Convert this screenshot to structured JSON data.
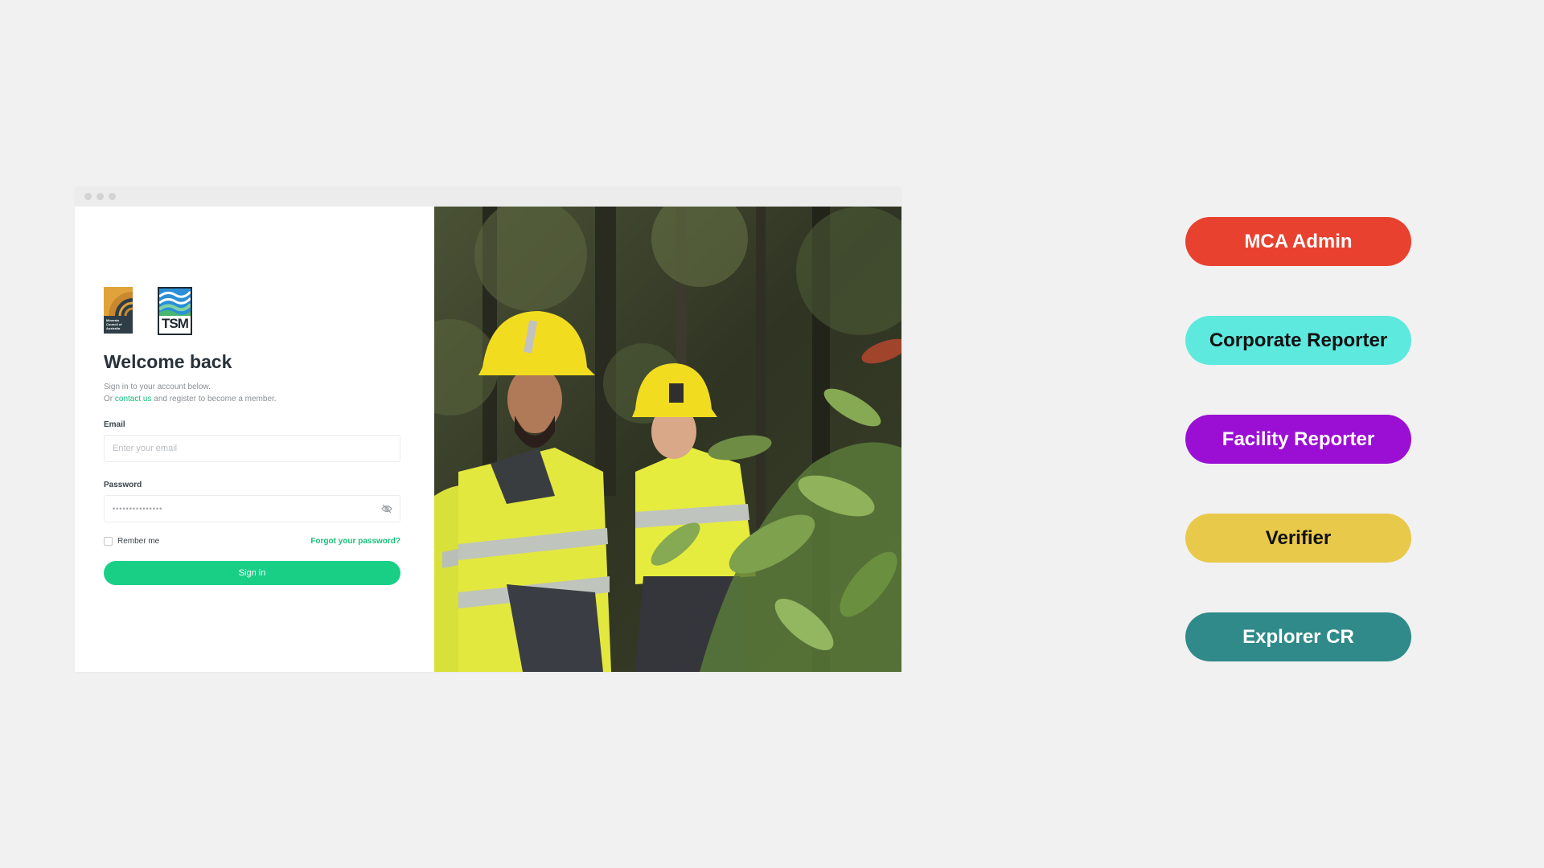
{
  "login": {
    "logo_mca_text": "Minerals Council of Australia",
    "logo_tsm_text": "TSM",
    "title": "Welcome back",
    "subtitle_line1": "Sign in to your account below.",
    "subtitle_or": "Or",
    "contact_link": "contact us",
    "subtitle_rest": "and register to become a member.",
    "email_label": "Email",
    "email_placeholder": "Enter your email",
    "password_label": "Password",
    "password_value": "•••••••••••••••",
    "remember_label": "Rember me",
    "forgot_label": "Forgot your password?",
    "signin_label": "Sign in"
  },
  "roles": [
    {
      "label": "MCA Admin",
      "bg": "#e8412f",
      "fg": "#ffffff"
    },
    {
      "label": "Corporate Reporter",
      "bg": "#5ee9df",
      "fg": "#111111"
    },
    {
      "label": "Facility Reporter",
      "bg": "#9b0fd4",
      "fg": "#ffffff"
    },
    {
      "label": "Verifier",
      "bg": "#e9c94a",
      "fg": "#111111"
    },
    {
      "label": "Explorer CR",
      "bg": "#2f8a89",
      "fg": "#ffffff"
    }
  ],
  "colors": {
    "accent": "#19cf86",
    "link": "#17c07a"
  }
}
